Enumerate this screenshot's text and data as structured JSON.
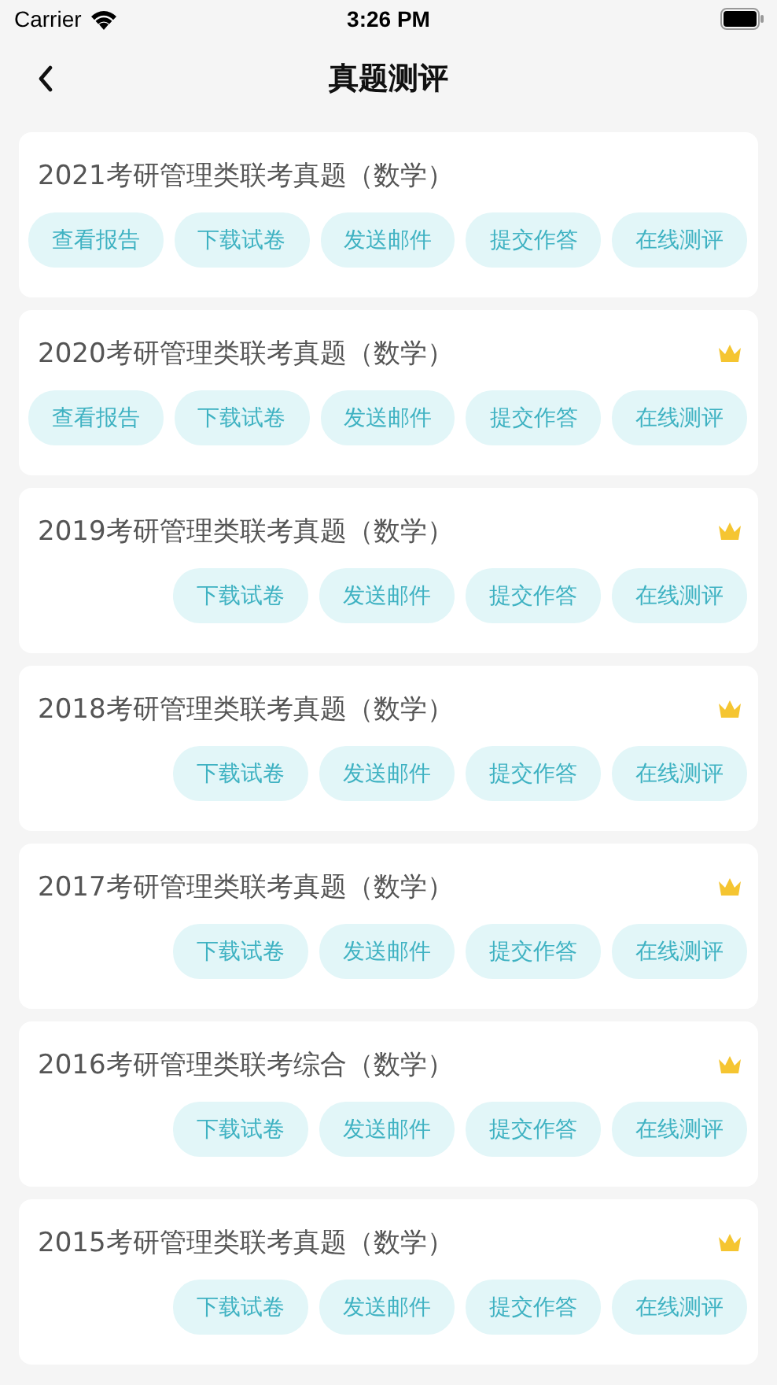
{
  "status_bar": {
    "carrier": "Carrier",
    "time": "3:26 PM"
  },
  "nav": {
    "title": "真题测评"
  },
  "papers": [
    {
      "title": "2021考研管理类联考真题（数学）",
      "premium": false,
      "buttons": [
        "查看报告",
        "下载试卷",
        "发送邮件",
        "提交作答",
        "在线测评"
      ]
    },
    {
      "title": "2020考研管理类联考真题（数学）",
      "premium": true,
      "buttons": [
        "查看报告",
        "下载试卷",
        "发送邮件",
        "提交作答",
        "在线测评"
      ]
    },
    {
      "title": "2019考研管理类联考真题（数学）",
      "premium": true,
      "buttons": [
        "下载试卷",
        "发送邮件",
        "提交作答",
        "在线测评"
      ]
    },
    {
      "title": "2018考研管理类联考真题（数学）",
      "premium": true,
      "buttons": [
        "下载试卷",
        "发送邮件",
        "提交作答",
        "在线测评"
      ]
    },
    {
      "title": "2017考研管理类联考真题（数学）",
      "premium": true,
      "buttons": [
        "下载试卷",
        "发送邮件",
        "提交作答",
        "在线测评"
      ]
    },
    {
      "title": "2016考研管理类联考综合（数学）",
      "premium": true,
      "buttons": [
        "下载试卷",
        "发送邮件",
        "提交作答",
        "在线测评"
      ]
    },
    {
      "title": "2015考研管理类联考真题（数学）",
      "premium": true,
      "buttons": [
        "下载试卷",
        "发送邮件",
        "提交作答",
        "在线测评"
      ]
    }
  ]
}
